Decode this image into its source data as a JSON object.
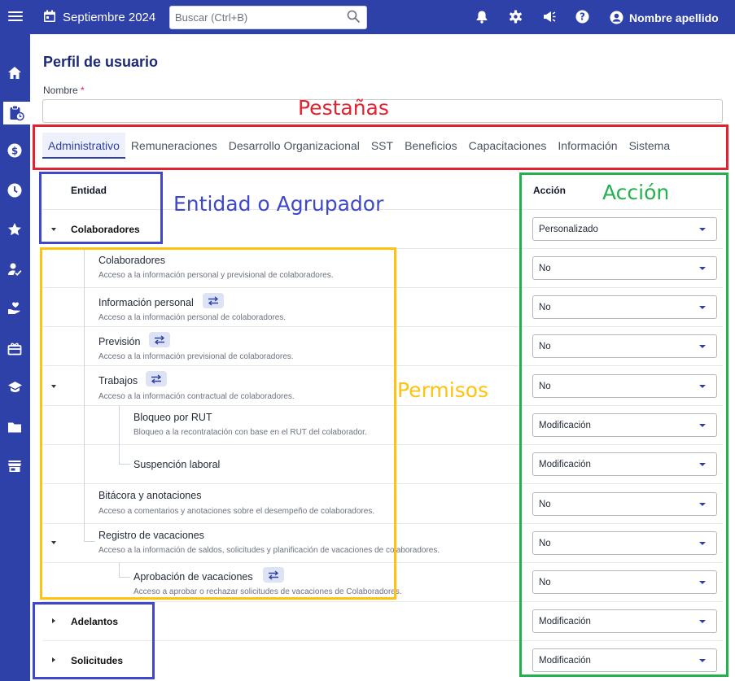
{
  "header": {
    "date": "Septiembre 2024",
    "search_placeholder": "Buscar (Ctrl+B)",
    "user_name": "Nombre apellido"
  },
  "page": {
    "title": "Perfil de usuario",
    "name_label": "Nombre",
    "required_mark": "*",
    "name_value": ""
  },
  "annotations": {
    "tabs": "Pestañas",
    "entity": "Entidad o Agrupador",
    "action": "Acción",
    "permissions": "Permisos",
    "colors": {
      "red": "#e3222f",
      "blue": "#3f48cc",
      "green": "#22b14c",
      "yellow": "#ffc20e"
    }
  },
  "tabs": [
    "Administrativo",
    "Remuneraciones",
    "Desarrollo Organizacional",
    "SST",
    "Beneficios",
    "Capacitaciones",
    "Información",
    "Sistema"
  ],
  "table": {
    "entity_header": "Entidad",
    "action_header": "Acción",
    "groups": [
      {
        "label": "Colaboradores",
        "action": "Personalizado",
        "expanded": true
      },
      {
        "label": "Adelantos",
        "action": "Modificación",
        "expanded": false
      },
      {
        "label": "Solicitudes",
        "action": "Modificación",
        "expanded": false
      }
    ],
    "permissions": [
      {
        "title": "Colaboradores",
        "desc": "Acceso a la información personal y previsional de colaboradores.",
        "action": "No",
        "swap": false
      },
      {
        "title": "Información personal",
        "desc": "Acceso a la información personal de colaboradores.",
        "action": "No",
        "swap": true
      },
      {
        "title": "Previsión",
        "desc": "Acceso a la información previsional de colaboradores.",
        "action": "No",
        "swap": true
      },
      {
        "title": "Trabajos",
        "desc": "Acceso a la información contractual de colaboradores.",
        "action": "No",
        "swap": true
      },
      {
        "title": "Bloqueo por RUT",
        "desc": "Bloqueo a la recontratación con base en el RUT del colaborador.",
        "action": "Modificación",
        "swap": false
      },
      {
        "title": "Suspención laboral",
        "desc": "",
        "action": "Modificación",
        "swap": false
      },
      {
        "title": "Bitácora y anotaciones",
        "desc": "Acceso a comentarios y anotaciones sobre el desempeño de colaboradores.",
        "action": "No",
        "swap": false
      },
      {
        "title": "Registro de vacaciones",
        "desc": "Acceso a la información de saldos, solicitudes y planificación de vacaciones de colaboradores.",
        "action": "No",
        "swap": false
      },
      {
        "title": "Aprobación de vacaciones",
        "desc": "Acceso a aprobar o rechazar solicitudes de vacaciones de Colaboradores.",
        "action": "No",
        "swap": true
      }
    ]
  },
  "sidebar_icons": [
    "home-icon",
    "clipboard-clock-icon",
    "dollar-icon",
    "clock-icon",
    "star-icon",
    "person-check-icon",
    "hand-heart-icon",
    "gift-icon",
    "graduation-cap-icon",
    "folder-icon",
    "store-icon"
  ]
}
